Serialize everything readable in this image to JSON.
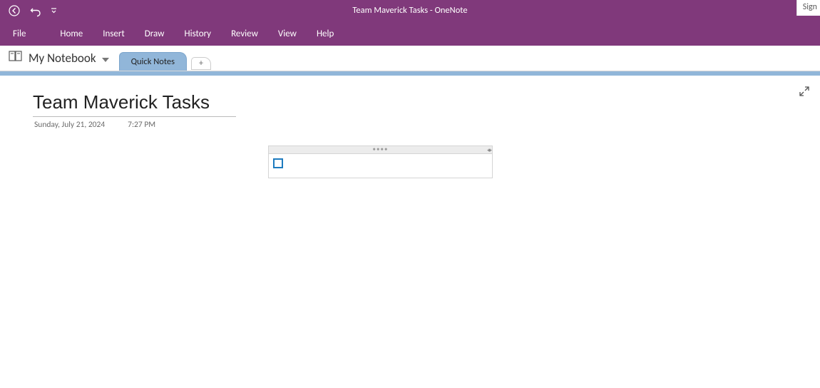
{
  "window": {
    "title": "Team Maverick Tasks  -  OneNote",
    "signin_label": "Sign"
  },
  "menu": {
    "items": [
      "File",
      "Home",
      "Insert",
      "Draw",
      "History",
      "Review",
      "View",
      "Help"
    ]
  },
  "notebook": {
    "name": "My Notebook"
  },
  "sections": {
    "active": "Quick Notes",
    "add_label": "+"
  },
  "page": {
    "title": "Team Maverick Tasks",
    "date": "Sunday, July 21, 2024",
    "time": "7:27 PM"
  },
  "note_container": {
    "todo_checked": false,
    "text": ""
  }
}
